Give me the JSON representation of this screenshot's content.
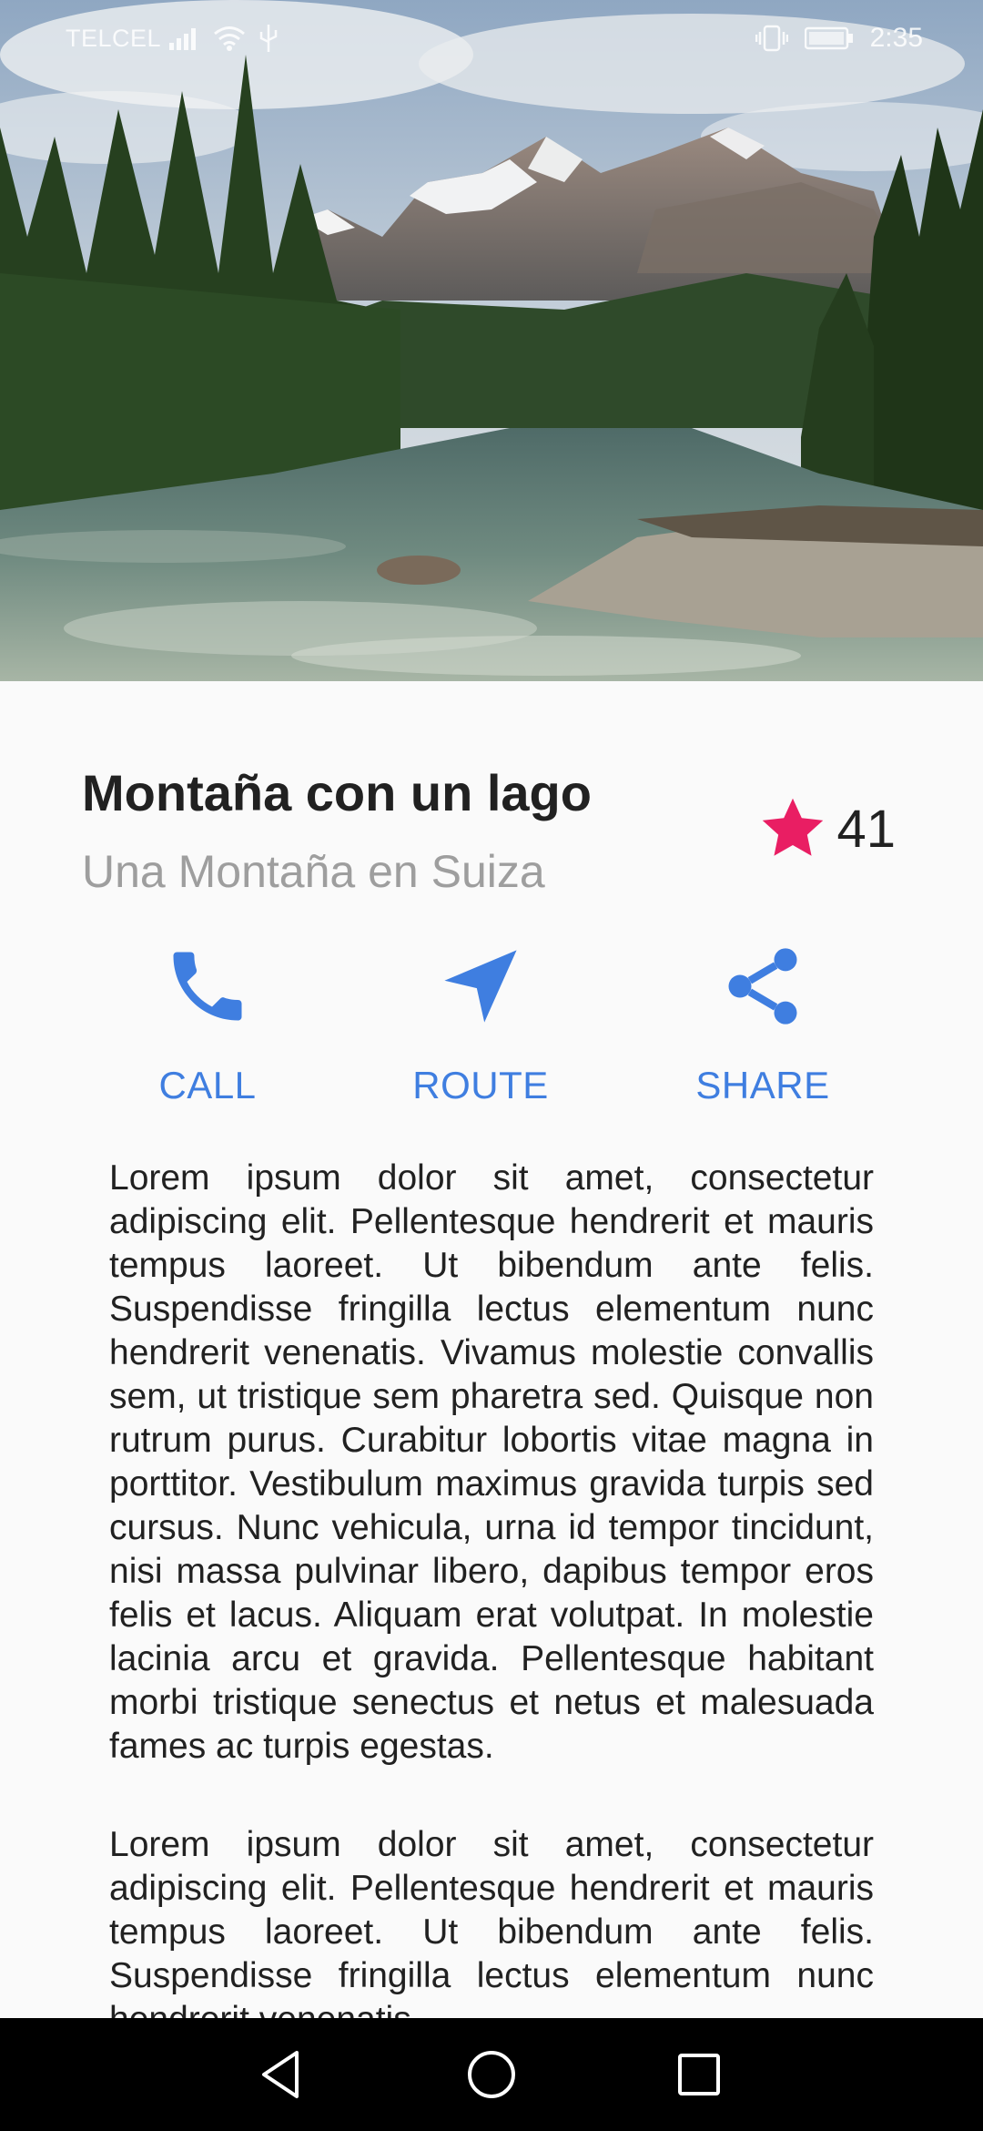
{
  "status_bar": {
    "carrier": "TELCEL",
    "time": "2:35"
  },
  "place": {
    "title": "Montaña con un lago",
    "subtitle": "Una Montaña en Suiza",
    "rating_count": "41"
  },
  "actions": {
    "call_label": "CALL",
    "route_label": "ROUTE",
    "share_label": "SHARE"
  },
  "content": {
    "paragraph_1": "Lorem ipsum dolor sit amet, consectetur adipiscing elit. Pellentesque hendrerit et mauris tempus laoreet. Ut bibendum ante felis. Suspendisse fringilla lectus elementum nunc hendrerit venenatis. Vivamus molestie convallis sem, ut tristique sem pharetra sed. Quisque non rutrum purus. Curabitur lobortis vitae magna in porttitor. Vestibulum maximus gravida turpis sed cursus. Nunc vehicula, urna id tempor tincidunt, nisi massa pulvinar libero, dapibus tempor eros felis et lacus. Aliquam erat volutpat. In molestie lacinia arcu et gravida. Pellentesque habitant morbi tristique senectus et netus et malesuada fames ac turpis egestas.",
    "paragraph_2": "Lorem ipsum dolor sit amet, consectetur adipiscing elit. Pellentesque hendrerit et mauris tempus laoreet. Ut bibendum ante felis. Suspendisse fringilla lectus elementum nunc hendrerit venenatis."
  },
  "colors": {
    "accent": "#3f7ee0",
    "star": "#e91e63",
    "title": "#212121",
    "subtitle": "#9e9e9e",
    "background": "#fafafa"
  },
  "icons": {
    "rating": "star-icon",
    "call": "phone-icon",
    "route": "navigation-arrow-icon",
    "share": "share-icon",
    "nav_back": "back-triangle-icon",
    "nav_home": "home-circle-icon",
    "nav_recent": "recent-apps-square-icon"
  }
}
